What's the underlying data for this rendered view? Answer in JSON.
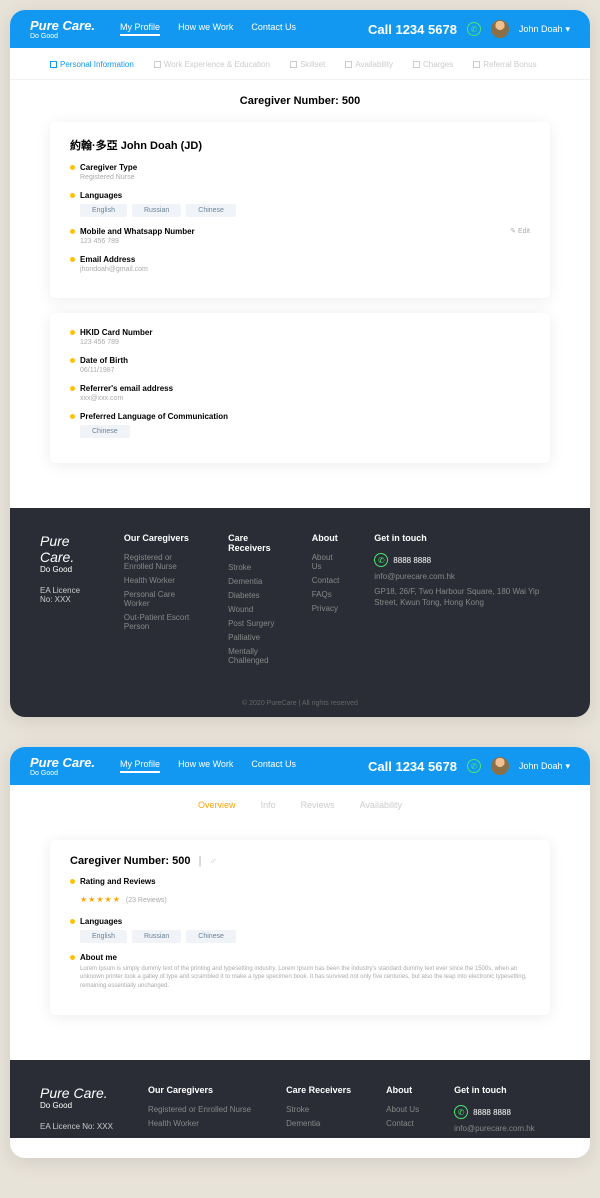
{
  "brand": {
    "name": "Pure Care.",
    "tagline": "Do Good"
  },
  "nav": {
    "profile": "My Profile",
    "how": "How we Work",
    "contact": "Contact Us"
  },
  "header": {
    "call": "Call 1234 5678",
    "user": "John Doah"
  },
  "tabs": {
    "personal": "Personal Information",
    "work": "Work Experience & Education",
    "skill": "Skillset",
    "avail": "Availability",
    "charges": "Charges",
    "referral": "Referral Bonus"
  },
  "s1": {
    "pageTitle": "Caregiver Number: 500",
    "nameLine": "約翰·多亞   John Doah (JD)",
    "caregiverType": {
      "label": "Caregiver Type",
      "value": "Registered Nurse"
    },
    "languages": {
      "label": "Languages",
      "items": [
        "English",
        "Russian",
        "Chinese"
      ]
    },
    "mobile": {
      "label": "Mobile and Whatsapp Number",
      "value": "123 456 789",
      "edit": "Edit"
    },
    "email": {
      "label": "Email Address",
      "value": "jhondoah@gmail.com"
    },
    "hkid": {
      "label": "HKID Card Number",
      "value": "123 456 789"
    },
    "dob": {
      "label": "Date of Birth",
      "value": "06/11/1987"
    },
    "referrer": {
      "label": "Referrer's email address",
      "value": "xxx@xxx.com"
    },
    "prefLang": {
      "label": "Preferred Language of Communication",
      "chip": "Chinese"
    }
  },
  "footer": {
    "license": "EA Licence No: XXX",
    "caregivers": {
      "title": "Our Caregivers",
      "items": [
        "Registered or Enrolled Nurse",
        "Health Worker",
        "Personal Care Worker",
        "Out-Patient Escort Person"
      ]
    },
    "receivers": {
      "title": "Care Receivers",
      "items": [
        "Stroke",
        "Dementia",
        "Diabetes",
        "Wound",
        "Post Surgery",
        "Palliative",
        "Mentally Challenged"
      ]
    },
    "about": {
      "title": "About",
      "items": [
        "About Us",
        "Contact",
        "FAQs",
        "Privacy"
      ]
    },
    "touch": {
      "title": "Get in touch",
      "phone": "8888 8888",
      "email": "info@purecare.com.hk",
      "addr": "GP18, 26/F, Two Harbour Square, 180 Wai Yip Street, Kwun Tong, Hong Kong"
    },
    "copyright": "© 2020 PureCare   |   All rights reserved"
  },
  "tabs2": {
    "overview": "Overview",
    "info": "Info",
    "reviews": "Reviews",
    "avail": "Availability"
  },
  "s2": {
    "header": "Caregiver Number: 500",
    "sep": "|",
    "rating": {
      "label": "Rating and Reviews",
      "count": "(23 Reviews)"
    },
    "languages": {
      "label": "Languages",
      "items": [
        "English",
        "Russian",
        "Chinese"
      ]
    },
    "about": {
      "label": "About me",
      "text": "Lorem Ipsum is simply dummy text of the printing and typesetting industry. Lorem Ipsum has been the industry's standard dummy text ever since the 1500s, when an unknown printer took a galley of type and scrambled it to make a type specimen book. It has survived not only five centuries, but also the leap into electronic typesetting, remaining essentially unchanged."
    }
  },
  "footer2": {
    "receivers": {
      "items": [
        "Stroke",
        "Dementia"
      ]
    },
    "about": {
      "items": [
        "About Us",
        "Contact"
      ]
    },
    "touch": {
      "phone": "8888 8888",
      "email": "info@purecare.com.hk"
    }
  }
}
